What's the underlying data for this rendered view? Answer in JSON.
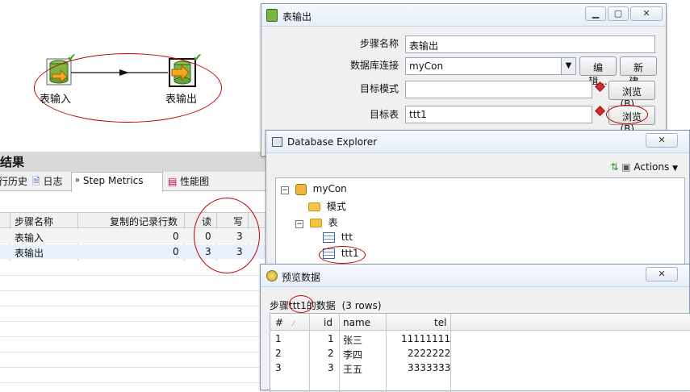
{
  "canvas": {
    "step_input_label": "表输入",
    "step_output_label": "表输出"
  },
  "results": {
    "title": "结果",
    "tabs": [
      "行历史",
      "日志",
      "Step Metrics",
      "性能图"
    ],
    "columns": [
      "步骤名称",
      "复制的记录行数",
      "读",
      "写"
    ],
    "rows": [
      {
        "name": "表输入",
        "copied": "0",
        "read": "0",
        "write": "3"
      },
      {
        "name": "表输出",
        "copied": "0",
        "read": "3",
        "write": "3"
      }
    ]
  },
  "table_output_dialog": {
    "title": "表输出",
    "step_name_label": "步骤名称",
    "step_name_value": "表输出",
    "db_conn_label": "数据库连接",
    "db_conn_value": "myCon",
    "edit_button": "编辑...",
    "new_button": "新建...",
    "target_schema_label": "目标模式",
    "target_schema_value": "",
    "browse_button_1": "浏览(B)...",
    "target_table_label": "目标表",
    "target_table_value": "ttt1",
    "browse_button_2": "浏览(B)..."
  },
  "db_explorer": {
    "title": "Database Explorer",
    "actions_label": "Actions",
    "tree": {
      "connection": "myCon",
      "schemas": "模式",
      "tables": "表",
      "table_items": [
        "ttt",
        "ttt1"
      ]
    }
  },
  "preview": {
    "title": "预览数据",
    "caption_prefix": "步骤",
    "caption_step": "ttt1",
    "caption_suffix": "的数据",
    "caption_rows": "(3 rows)",
    "columns": [
      "#",
      "id",
      "name",
      "tel"
    ],
    "rows": [
      {
        "n": "1",
        "id": "1",
        "name": "张三",
        "tel": "11111111"
      },
      {
        "n": "2",
        "id": "2",
        "name": "李四",
        "tel": "2222222"
      },
      {
        "n": "3",
        "id": "3",
        "name": "王五",
        "tel": "3333333"
      }
    ]
  },
  "colors": {
    "annotation_red": "#c00000",
    "window_border": "#8a99ad",
    "selected_row": "#e8f1fb"
  }
}
